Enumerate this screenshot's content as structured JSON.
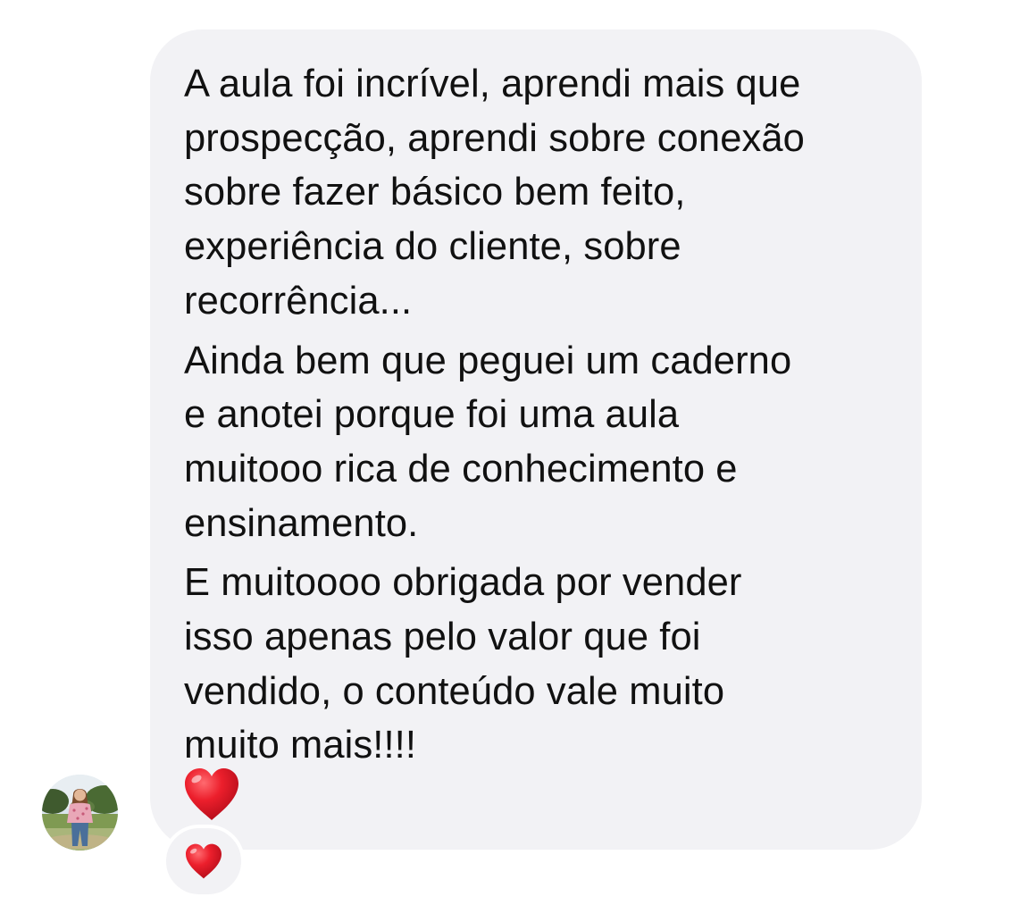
{
  "message": {
    "paragraphs": [
      "A aula foi incrível, aprendi mais que\nprospecção, aprendi sobre conexão\nsobre fazer básico bem feito,\nexperiência do cliente, sobre\nrecorrência...",
      "Ainda bem que peguei um caderno\ne anotei porque foi uma aula\nmuitooo rica de conhecimento e\nensinamento.",
      "E muitoooo obrigada por vender\nisso apenas pelo valor que foi\nvendido, o conteúdo vale muito\nmuito mais!!!!"
    ],
    "emoji": "red-heart-emoji",
    "bubble_color": "#f2f2f5",
    "text_color": "#111111"
  },
  "reaction": {
    "icon": "red-heart-icon",
    "color": "#e8232d"
  },
  "sender": {
    "avatar_icon": "user-avatar"
  }
}
